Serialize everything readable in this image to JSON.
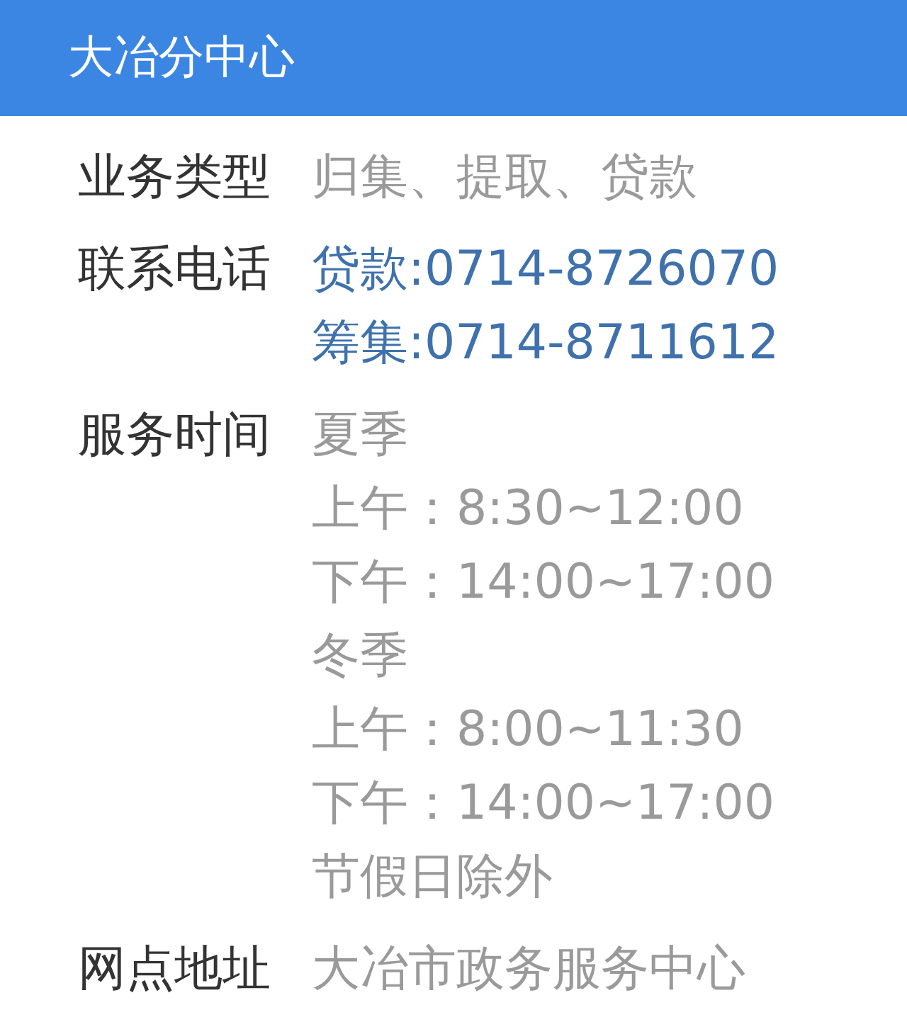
{
  "header": {
    "title": "大冶分中心"
  },
  "rows": [
    {
      "label": "业务类型",
      "kind": "text",
      "lines": [
        "归集、提取、贷款"
      ]
    },
    {
      "label": "联系电话",
      "kind": "phone",
      "lines": [
        "贷款:0714-8726070",
        "筹集:0714-8711612"
      ]
    },
    {
      "label": "服务时间",
      "kind": "text",
      "lines": [
        "夏季",
        "上午：8:30~12:00",
        "下午：14:00~17:00",
        "冬季",
        "上午：8:00~11:30",
        "下午：14:00~17:00",
        "节假日除外"
      ]
    },
    {
      "label": "网点地址",
      "kind": "text",
      "lines": [
        "大冶市政务服务中心"
      ]
    }
  ]
}
